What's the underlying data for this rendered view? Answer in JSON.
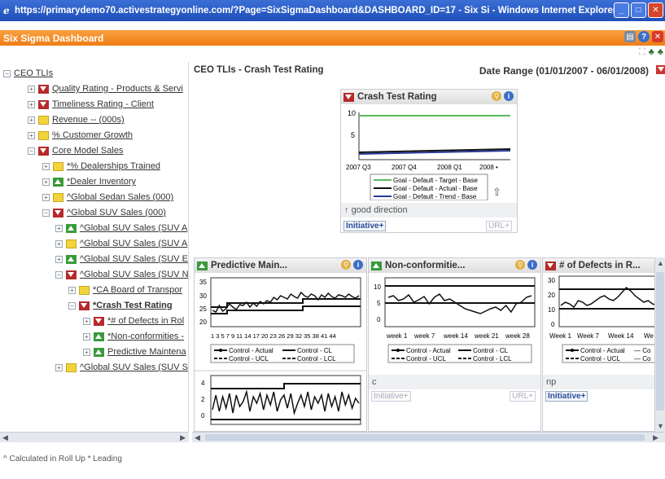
{
  "window": {
    "title": "https://primarydemo70.activestrategyonline.com/?Page=SixSigmaDashboard&DASHBOARD_ID=17 - Six Si - Windows Internet Explorer"
  },
  "app": {
    "title": "Six Sigma Dashboard"
  },
  "tree": {
    "items": [
      {
        "label": "CEO TLIs",
        "icon": "none",
        "pm": "−"
      },
      {
        "label": "Quality Rating - Products & Servi",
        "icon": "red",
        "pm": "+"
      },
      {
        "label": "Timeliness Rating - Client",
        "icon": "red",
        "pm": "+"
      },
      {
        "label": "Revenue -- (000s)",
        "icon": "yellow",
        "pm": "+"
      },
      {
        "label": "% Customer Growth",
        "icon": "yellow",
        "pm": "+"
      },
      {
        "label": "Core Model Sales",
        "icon": "red",
        "pm": "−"
      },
      {
        "label": "*% Dealerships Trained",
        "icon": "yellow",
        "pm": "+"
      },
      {
        "label": "*Dealer Inventory",
        "icon": "green",
        "pm": "+"
      },
      {
        "label": "^Global Sedan Sales (000)",
        "icon": "yellow",
        "pm": "+"
      },
      {
        "label": "^Global SUV Sales (000)",
        "icon": "red",
        "pm": "−"
      },
      {
        "label": "^Global SUV Sales (SUV A",
        "icon": "green",
        "pm": "+"
      },
      {
        "label": "^Global SUV Sales (SUV A",
        "icon": "yellow",
        "pm": "+"
      },
      {
        "label": "^Global SUV Sales (SUV E",
        "icon": "green",
        "pm": "+"
      },
      {
        "label": "^Global SUV Sales (SUV N",
        "icon": "red",
        "pm": "−"
      },
      {
        "label": "*CA Board of Transpor",
        "icon": "yellow",
        "pm": "+"
      },
      {
        "label": "*Crash Test Rating",
        "icon": "red",
        "pm": "−"
      },
      {
        "label": "*# of Defects in Rol",
        "icon": "red",
        "pm": "+"
      },
      {
        "label": "*Non-conformities -",
        "icon": "green",
        "pm": "+"
      },
      {
        "label": "Predictive Maintena",
        "icon": "green",
        "pm": "+"
      },
      {
        "label": "^Global SUV Sales (SUV S",
        "icon": "yellow",
        "pm": "+"
      }
    ]
  },
  "main": {
    "header_left": "CEO TLIs - Crash Test Rating",
    "date_range": "Date Range (01/01/2007 - 06/01/2008)"
  },
  "crash_panel": {
    "title": "Crash Test Rating",
    "ticks_y": [
      "10",
      "5"
    ],
    "ticks_x": [
      "2007 Q3",
      "2007 Q4",
      "2008 Q1",
      "2008 •"
    ],
    "legend": [
      "Goal - Default - Target - Base",
      "Goal - Default - Actual - Base",
      "Goal - Default - Trend - Base"
    ],
    "status": "good direction",
    "initiative": "Initiative+",
    "url": "URL+"
  },
  "pred_panel": {
    "title": "Predictive Main...",
    "ticks_y": [
      "35",
      "30",
      "25",
      "20"
    ],
    "ticks_x": "1 3 5 7 9 11 14 17 20 23 26 29 32 35 38 41 44",
    "legend": [
      "Control - Actual",
      "Control - CL",
      "Control - UCL",
      "Control - LCL"
    ],
    "ticks_y2": [
      "4",
      "2",
      "0"
    ]
  },
  "nonconf_panel": {
    "title": "Non-conformitie...",
    "ticks_y": [
      "10",
      "5",
      "0"
    ],
    "ticks_x": [
      "week 1",
      "week 7",
      "week 14",
      "week 21",
      "week 28"
    ],
    "legend": [
      "Control - Actual",
      "Control - CL",
      "Control - UCL",
      "Control - LCL"
    ],
    "strip": "c",
    "initiative": "Initiative+",
    "url": "URL+"
  },
  "defects_panel": {
    "title": "# of Defects in R...",
    "ticks_y": [
      "30",
      "20",
      "10",
      "0"
    ],
    "ticks_x": [
      "Week 1",
      "Week 7",
      "Week 14",
      "We"
    ],
    "legend": [
      "Control - Actual",
      "Control - UCL"
    ],
    "legend_trunc": [
      "— Co",
      "— Co"
    ],
    "strip": "np",
    "initiative": "Initiative+"
  },
  "footer": "^ Calculated in Roll Up  * Leading"
}
